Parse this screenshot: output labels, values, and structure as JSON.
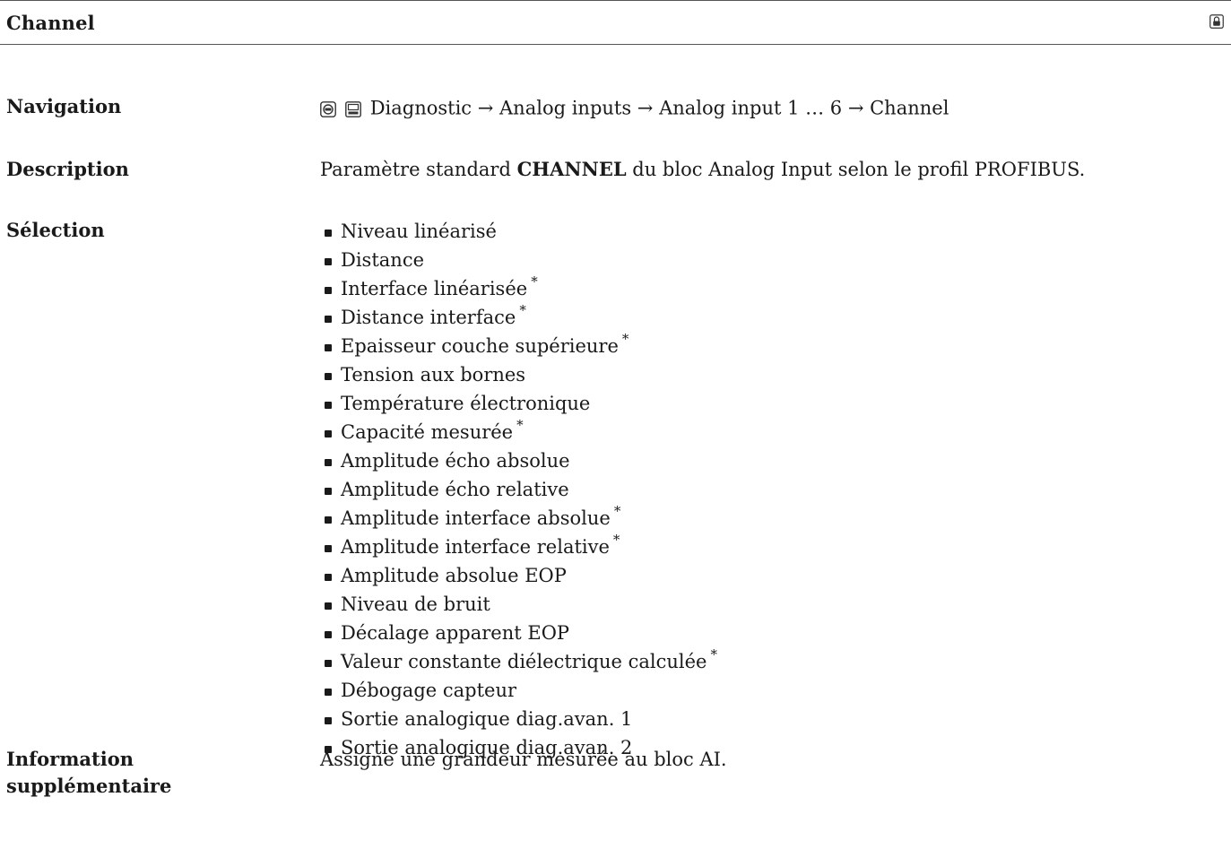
{
  "header": {
    "title": "Channel",
    "lock_icon": "lock-icon"
  },
  "navigation": {
    "label": "Navigation",
    "icons": [
      "expert-menu-icon",
      "display-icon"
    ],
    "path": "Diagnostic → Analog inputs → Analog input 1 … 6 → Channel"
  },
  "description": {
    "label": "Description",
    "before": "Paramètre standard ",
    "bold": "CHANNEL",
    "after": " du bloc Analog Input selon le profil PROFIBUS."
  },
  "selection": {
    "label": "Sélection",
    "items": [
      {
        "text": "Niveau linéarisé",
        "asterisk": ""
      },
      {
        "text": "Distance",
        "asterisk": ""
      },
      {
        "text": "Interface linéarisée",
        "asterisk": "*"
      },
      {
        "text": "Distance interface",
        "asterisk": "*"
      },
      {
        "text": "Epaisseur couche supérieure",
        "asterisk": "*"
      },
      {
        "text": "Tension aux bornes",
        "asterisk": ""
      },
      {
        "text": "Température électronique",
        "asterisk": ""
      },
      {
        "text": "Capacité mesurée",
        "asterisk": "*"
      },
      {
        "text": "Amplitude écho absolue",
        "asterisk": ""
      },
      {
        "text": "Amplitude écho relative",
        "asterisk": ""
      },
      {
        "text": "Amplitude interface absolue",
        "asterisk": "*"
      },
      {
        "text": "Amplitude interface relative",
        "asterisk": "*"
      },
      {
        "text": "Amplitude absolue EOP",
        "asterisk": ""
      },
      {
        "text": "Niveau de bruit",
        "asterisk": ""
      },
      {
        "text": "Décalage apparent EOP",
        "asterisk": ""
      },
      {
        "text": "Valeur constante diélectrique calculée",
        "asterisk": "*"
      },
      {
        "text": "Débogage capteur",
        "asterisk": ""
      },
      {
        "text": "Sortie analogique diag.avan. 1",
        "asterisk": ""
      },
      {
        "text": "Sortie analogique diag.avan. 2",
        "asterisk": ""
      }
    ]
  },
  "additional_info": {
    "label_line1": "Information",
    "label_line2": "supplémentaire",
    "text": "Assigne une grandeur mesurée au bloc AI."
  }
}
